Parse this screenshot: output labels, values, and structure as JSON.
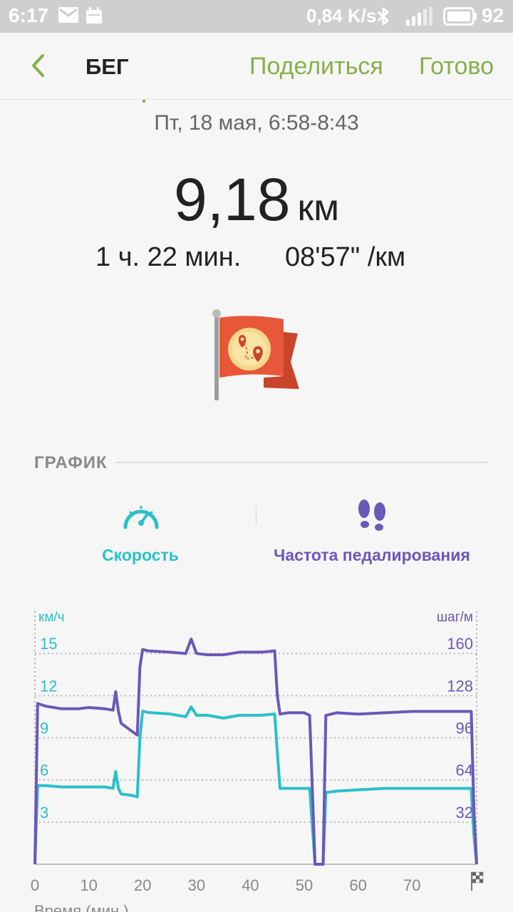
{
  "status_bar": {
    "time": "6:17",
    "network_speed": "0,84 K/s",
    "battery": "92",
    "icons": [
      "mail-icon",
      "calendar-icon",
      "bluetooth-icon",
      "signal-icon",
      "battery-icon"
    ]
  },
  "app_bar": {
    "title": "БЕГ",
    "share_label": "Поделиться",
    "done_label": "Готово",
    "accent_color": "#86b04a"
  },
  "summary": {
    "date": "Пт, 18 мая, 6:58-8:43",
    "distance_value": "9,18",
    "distance_unit": "км",
    "duration": "1 ч. 22 мин.",
    "pace": "08'57\" /км"
  },
  "section": {
    "title": "ГРАФИК"
  },
  "tabs": [
    {
      "label": "Скорость",
      "icon": "speedometer-icon",
      "color": "#2cbfc9"
    },
    {
      "label": "Частота педалирования",
      "icon": "footprints-icon",
      "color": "#6b58b8"
    }
  ],
  "chart_data": {
    "type": "line",
    "title": "",
    "xlabel": "Время (мин.)",
    "left_unit": "км/ч",
    "right_unit": "шаг/м",
    "x_ticks": [
      "0",
      "10",
      "20",
      "30",
      "40",
      "50",
      "60",
      "70"
    ],
    "xlim": [
      0,
      82
    ],
    "left_ticks": [
      "15",
      "12",
      "9",
      "6",
      "3"
    ],
    "left_ylim": [
      0,
      18
    ],
    "right_ticks": [
      "160",
      "128",
      "96",
      "64",
      "32"
    ],
    "right_ylim": [
      0,
      192
    ],
    "grid": true,
    "series": [
      {
        "name": "Скорость",
        "axis": "left",
        "color": "#2cbfc9",
        "x": [
          0,
          0.5,
          2,
          5,
          8,
          10,
          13,
          14.5,
          15,
          15.5,
          16,
          18,
          19,
          19.5,
          20,
          21,
          25,
          28,
          29,
          30,
          32,
          35,
          38,
          42,
          44.5,
          45,
          45.5,
          47,
          50,
          51,
          52,
          53,
          53.5,
          54,
          56,
          60,
          65,
          70,
          75,
          80,
          81,
          81.5,
          82
        ],
        "values": [
          0,
          5.6,
          5.6,
          5.5,
          5.5,
          5.5,
          5.5,
          5.4,
          6.6,
          5.4,
          5.0,
          4.9,
          4.8,
          9.0,
          10.9,
          10.8,
          10.7,
          10.5,
          11.2,
          10.6,
          10.6,
          10.4,
          10.6,
          10.6,
          10.7,
          8.0,
          5.4,
          5.4,
          5.4,
          5.4,
          0,
          0,
          0,
          5.1,
          5.2,
          5.3,
          5.4,
          5.4,
          5.4,
          5.4,
          5.4,
          2.0,
          0
        ]
      },
      {
        "name": "Частота педалирования",
        "axis": "right",
        "color": "#6b58b8",
        "x": [
          0,
          0.5,
          2,
          5,
          8,
          10,
          13,
          14.5,
          15,
          15.5,
          16,
          18,
          19,
          19.5,
          20,
          21,
          25,
          28,
          29,
          30,
          32,
          35,
          38,
          42,
          44.5,
          45,
          45.5,
          47,
          50,
          51,
          52,
          53,
          53.5,
          54,
          56,
          60,
          65,
          70,
          75,
          80,
          81,
          81.5,
          82
        ],
        "values": [
          0,
          122,
          120,
          118,
          118,
          119,
          118,
          117,
          131,
          116,
          107,
          101,
          98,
          150,
          163,
          162,
          161,
          160,
          171,
          160,
          159,
          159,
          161,
          161,
          162,
          128,
          114,
          115,
          115,
          113,
          0,
          0,
          0,
          113,
          115,
          114,
          115,
          116,
          116,
          116,
          116,
          40,
          0
        ]
      }
    ]
  }
}
